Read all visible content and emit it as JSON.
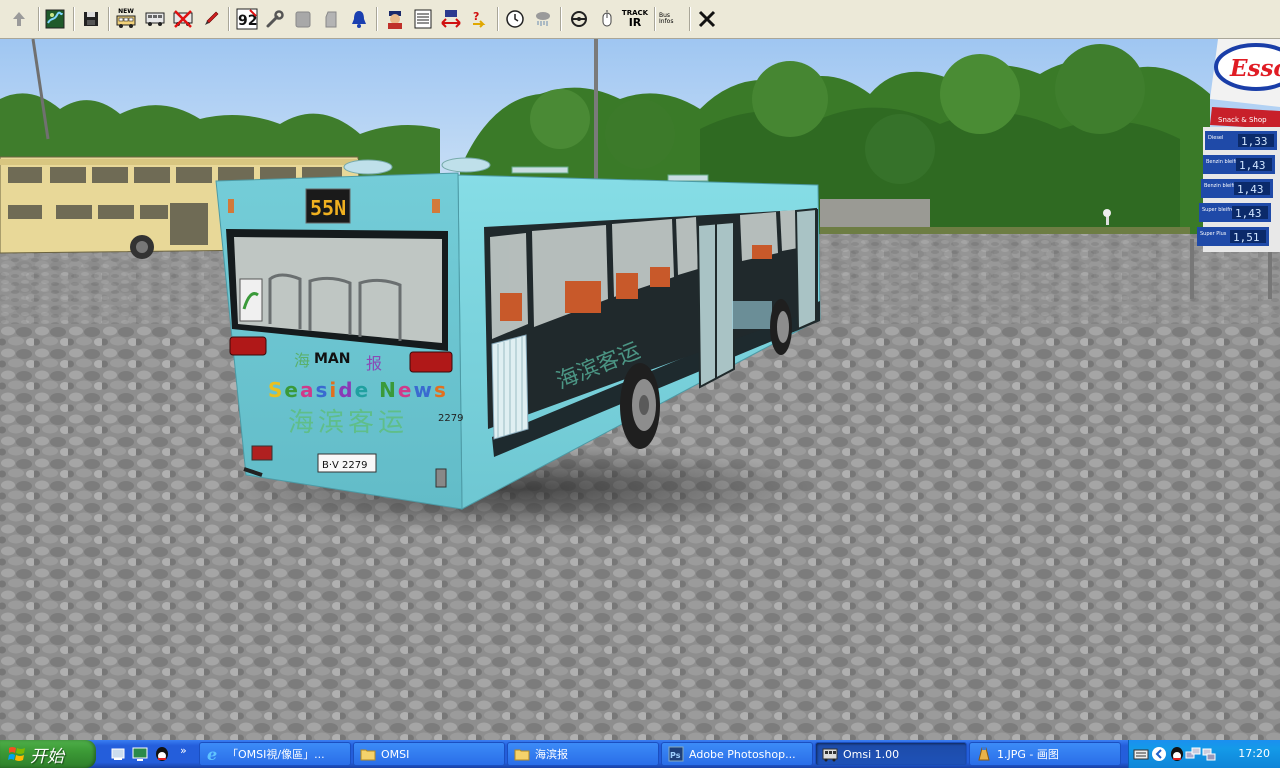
{
  "toolbar": {
    "buttons": [
      {
        "name": "up-arrow-icon"
      },
      {
        "name": "map-icon"
      },
      {
        "name": "save-icon"
      },
      {
        "name": "new-bus-icon",
        "label": "NEW"
      },
      {
        "name": "bus-icon"
      },
      {
        "name": "remove-bus-icon"
      },
      {
        "name": "pen-icon"
      },
      {
        "name": "route-number-icon",
        "label": "92"
      },
      {
        "name": "wrench-icon"
      },
      {
        "name": "seat-icon"
      },
      {
        "name": "door-icon"
      },
      {
        "name": "bell-icon"
      },
      {
        "name": "driver-icon"
      },
      {
        "name": "timetable-icon"
      },
      {
        "name": "swap-icon"
      },
      {
        "name": "help-icon"
      },
      {
        "name": "clock-icon"
      },
      {
        "name": "weather-icon"
      },
      {
        "name": "steering-wheel-icon"
      },
      {
        "name": "mouse-icon"
      },
      {
        "name": "trackir-icon",
        "label_top": "TRACK",
        "label_bottom": "IR"
      },
      {
        "name": "options-icon",
        "line1": "Bus",
        "line2": "Infos"
      },
      {
        "name": "close-icon"
      }
    ]
  },
  "scene": {
    "bus": {
      "destination": "55N",
      "brand": "MAN",
      "ad_line1": "Seaside News",
      "ad_line2": "海滨客运",
      "ad_char_left": "海",
      "ad_char_right": "报",
      "fleet_number": "2279",
      "plate": "B·V 2279",
      "side_text": "海滨客运",
      "color": "#7fd3dd"
    },
    "sign": {
      "brand": "Esso",
      "shop": "Snack & Shop",
      "prices": [
        "1,33",
        "1,43",
        "1,43",
        "1,43",
        "1,51"
      ],
      "labels": [
        "Diesel",
        "Benzin bleifrei",
        "Benzin bleifrei",
        "Super bleifrei",
        "Super Plus"
      ]
    }
  },
  "taskbar": {
    "start_label": "开始",
    "tasks": [
      {
        "label": "「OMSI視/像區」...",
        "icon": "ie-icon"
      },
      {
        "label": "OMSI",
        "icon": "folder-icon"
      },
      {
        "label": "海滨报",
        "icon": "folder-icon"
      },
      {
        "label": "Adobe Photoshop...",
        "icon": "photoshop-icon"
      },
      {
        "label": "Omsi 1.00",
        "icon": "omsi-icon",
        "active": true
      },
      {
        "label": "1.JPG - 画图",
        "icon": "paint-icon"
      }
    ],
    "clock": "17:20"
  }
}
